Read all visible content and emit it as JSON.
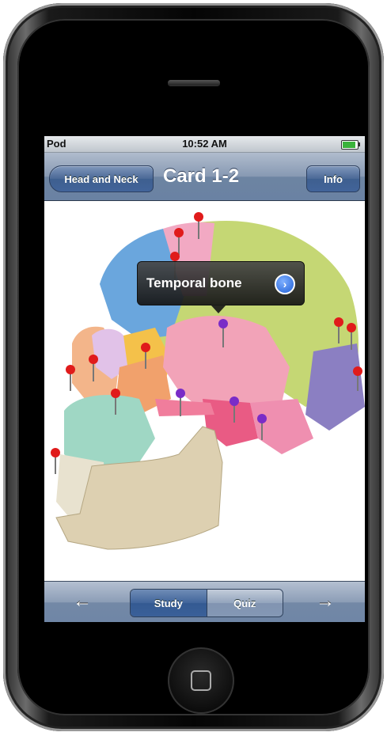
{
  "status_bar": {
    "carrier": "Pod",
    "time": "10:52 AM"
  },
  "nav_bar": {
    "back_label": "Head and Neck",
    "title": "Card 1-2",
    "info_label": "Info"
  },
  "callout": {
    "label": "Temporal bone"
  },
  "toolbar": {
    "prev_arrow": "←",
    "next_arrow": "→",
    "segments": [
      "Study",
      "Quiz"
    ],
    "selected_segment": "Study"
  },
  "icons": {
    "pin_red": "#e01b1b",
    "pin_purple": "#7a2cc7"
  }
}
